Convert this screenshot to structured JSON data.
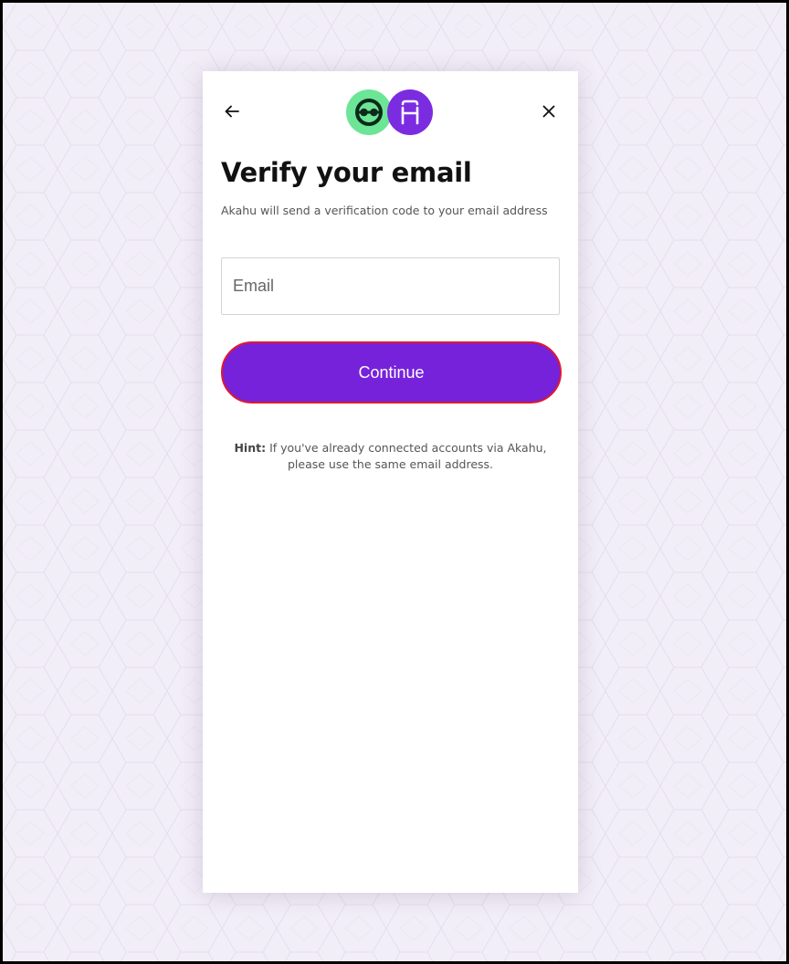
{
  "header": {
    "back_icon": "arrow-left-icon",
    "close_icon": "close-icon",
    "logos": [
      {
        "name": "app-logo",
        "color": "#6ce597"
      },
      {
        "name": "akahu-logo",
        "color": "#7b2ce0"
      }
    ]
  },
  "main": {
    "title": "Verify your email",
    "subtitle": "Akahu will send a verification code to your email address",
    "email_placeholder": "Email",
    "email_value": "",
    "continue_label": "Continue",
    "hint_label": "Hint:",
    "hint_text": " If you've already connected accounts via Akahu, please use the same email address."
  },
  "colors": {
    "accent": "#7622db",
    "focus_outline": "#e0182d",
    "background": "#f2eef7"
  }
}
